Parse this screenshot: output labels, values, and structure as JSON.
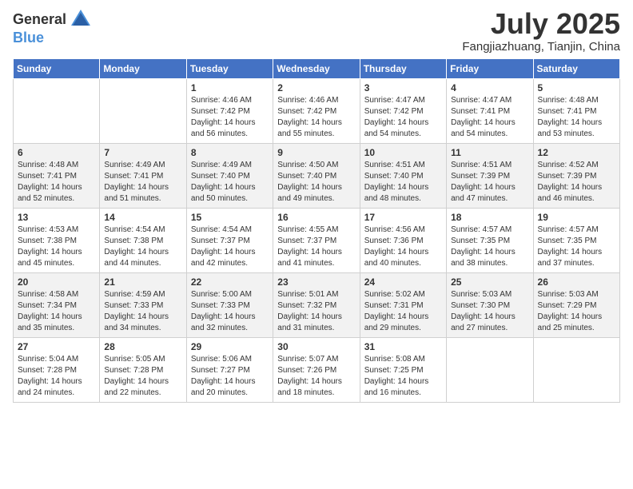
{
  "header": {
    "logo_general": "General",
    "logo_blue": "Blue",
    "title": "July 2025",
    "location": "Fangjiazhuang, Tianjin, China"
  },
  "weekdays": [
    "Sunday",
    "Monday",
    "Tuesday",
    "Wednesday",
    "Thursday",
    "Friday",
    "Saturday"
  ],
  "weeks": [
    [
      {
        "day": "",
        "info": ""
      },
      {
        "day": "",
        "info": ""
      },
      {
        "day": "1",
        "info": "Sunrise: 4:46 AM\nSunset: 7:42 PM\nDaylight: 14 hours\nand 56 minutes."
      },
      {
        "day": "2",
        "info": "Sunrise: 4:46 AM\nSunset: 7:42 PM\nDaylight: 14 hours\nand 55 minutes."
      },
      {
        "day": "3",
        "info": "Sunrise: 4:47 AM\nSunset: 7:42 PM\nDaylight: 14 hours\nand 54 minutes."
      },
      {
        "day": "4",
        "info": "Sunrise: 4:47 AM\nSunset: 7:41 PM\nDaylight: 14 hours\nand 54 minutes."
      },
      {
        "day": "5",
        "info": "Sunrise: 4:48 AM\nSunset: 7:41 PM\nDaylight: 14 hours\nand 53 minutes."
      }
    ],
    [
      {
        "day": "6",
        "info": "Sunrise: 4:48 AM\nSunset: 7:41 PM\nDaylight: 14 hours\nand 52 minutes."
      },
      {
        "day": "7",
        "info": "Sunrise: 4:49 AM\nSunset: 7:41 PM\nDaylight: 14 hours\nand 51 minutes."
      },
      {
        "day": "8",
        "info": "Sunrise: 4:49 AM\nSunset: 7:40 PM\nDaylight: 14 hours\nand 50 minutes."
      },
      {
        "day": "9",
        "info": "Sunrise: 4:50 AM\nSunset: 7:40 PM\nDaylight: 14 hours\nand 49 minutes."
      },
      {
        "day": "10",
        "info": "Sunrise: 4:51 AM\nSunset: 7:40 PM\nDaylight: 14 hours\nand 48 minutes."
      },
      {
        "day": "11",
        "info": "Sunrise: 4:51 AM\nSunset: 7:39 PM\nDaylight: 14 hours\nand 47 minutes."
      },
      {
        "day": "12",
        "info": "Sunrise: 4:52 AM\nSunset: 7:39 PM\nDaylight: 14 hours\nand 46 minutes."
      }
    ],
    [
      {
        "day": "13",
        "info": "Sunrise: 4:53 AM\nSunset: 7:38 PM\nDaylight: 14 hours\nand 45 minutes."
      },
      {
        "day": "14",
        "info": "Sunrise: 4:54 AM\nSunset: 7:38 PM\nDaylight: 14 hours\nand 44 minutes."
      },
      {
        "day": "15",
        "info": "Sunrise: 4:54 AM\nSunset: 7:37 PM\nDaylight: 14 hours\nand 42 minutes."
      },
      {
        "day": "16",
        "info": "Sunrise: 4:55 AM\nSunset: 7:37 PM\nDaylight: 14 hours\nand 41 minutes."
      },
      {
        "day": "17",
        "info": "Sunrise: 4:56 AM\nSunset: 7:36 PM\nDaylight: 14 hours\nand 40 minutes."
      },
      {
        "day": "18",
        "info": "Sunrise: 4:57 AM\nSunset: 7:35 PM\nDaylight: 14 hours\nand 38 minutes."
      },
      {
        "day": "19",
        "info": "Sunrise: 4:57 AM\nSunset: 7:35 PM\nDaylight: 14 hours\nand 37 minutes."
      }
    ],
    [
      {
        "day": "20",
        "info": "Sunrise: 4:58 AM\nSunset: 7:34 PM\nDaylight: 14 hours\nand 35 minutes."
      },
      {
        "day": "21",
        "info": "Sunrise: 4:59 AM\nSunset: 7:33 PM\nDaylight: 14 hours\nand 34 minutes."
      },
      {
        "day": "22",
        "info": "Sunrise: 5:00 AM\nSunset: 7:33 PM\nDaylight: 14 hours\nand 32 minutes."
      },
      {
        "day": "23",
        "info": "Sunrise: 5:01 AM\nSunset: 7:32 PM\nDaylight: 14 hours\nand 31 minutes."
      },
      {
        "day": "24",
        "info": "Sunrise: 5:02 AM\nSunset: 7:31 PM\nDaylight: 14 hours\nand 29 minutes."
      },
      {
        "day": "25",
        "info": "Sunrise: 5:03 AM\nSunset: 7:30 PM\nDaylight: 14 hours\nand 27 minutes."
      },
      {
        "day": "26",
        "info": "Sunrise: 5:03 AM\nSunset: 7:29 PM\nDaylight: 14 hours\nand 25 minutes."
      }
    ],
    [
      {
        "day": "27",
        "info": "Sunrise: 5:04 AM\nSunset: 7:28 PM\nDaylight: 14 hours\nand 24 minutes."
      },
      {
        "day": "28",
        "info": "Sunrise: 5:05 AM\nSunset: 7:28 PM\nDaylight: 14 hours\nand 22 minutes."
      },
      {
        "day": "29",
        "info": "Sunrise: 5:06 AM\nSunset: 7:27 PM\nDaylight: 14 hours\nand 20 minutes."
      },
      {
        "day": "30",
        "info": "Sunrise: 5:07 AM\nSunset: 7:26 PM\nDaylight: 14 hours\nand 18 minutes."
      },
      {
        "day": "31",
        "info": "Sunrise: 5:08 AM\nSunset: 7:25 PM\nDaylight: 14 hours\nand 16 minutes."
      },
      {
        "day": "",
        "info": ""
      },
      {
        "day": "",
        "info": ""
      }
    ]
  ]
}
